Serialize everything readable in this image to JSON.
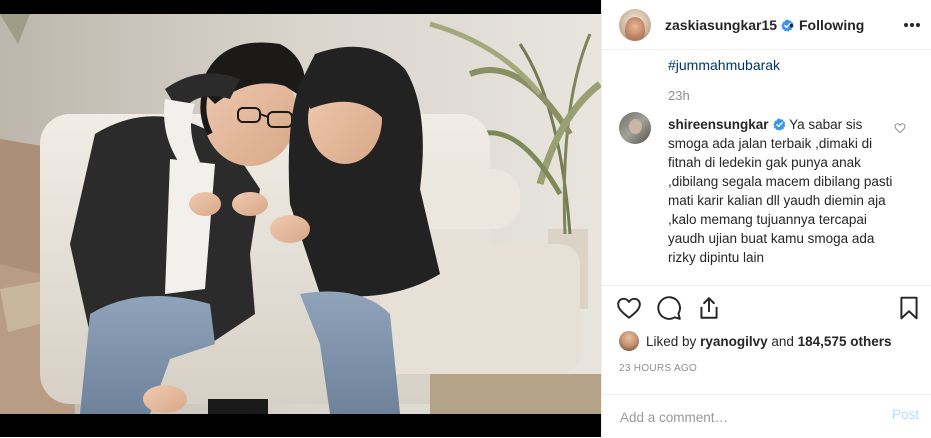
{
  "post": {
    "username": "zaskiasungkar15",
    "dot": "•",
    "follow_status": "Following",
    "photo_alt_icon": "photo"
  },
  "caption": {
    "hashtag": "#jummahmubarak",
    "time_ago": "23h"
  },
  "comment": {
    "username": "shireensungkar",
    "text": "Ya sabar sis smoga ada jalan terbaik ,dimaki di fitnah di ledekin gak punya anak ,dibilang segala macem dibilang pasti mati karir kalian dll yaudh diemin aja ,kalo memang tujuannya tercapai yaudh ujian buat kamu smoga ada rizky dipintu lain"
  },
  "likes": {
    "prefix": "Liked by",
    "user": "ryanogilvy",
    "conjunction": "and",
    "others": "184,575 others"
  },
  "timestamp": "23 HOURS AGO",
  "add_comment": {
    "placeholder": "Add a comment…",
    "post_label": "Post"
  },
  "colors": {
    "verified": "#3897f0",
    "hashtag": "#003569",
    "muted": "#8e8e8e",
    "post_disabled": "#b2dffc",
    "border": "#efefef"
  },
  "icons": [
    "verified-icon",
    "more-options-icon",
    "heart-icon",
    "comment-icon",
    "share-icon",
    "bookmark-icon",
    "comment-like-icon"
  ]
}
